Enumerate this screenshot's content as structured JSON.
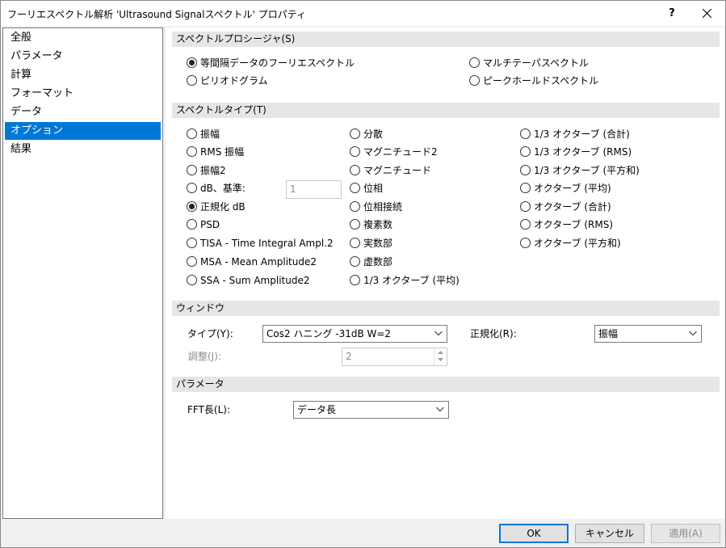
{
  "window": {
    "title": "フーリエスペクトル解析 'Ultrasound Signalスペクトル' プロパティ",
    "help_label": "?"
  },
  "sidebar": {
    "items": [
      {
        "label": "全般"
      },
      {
        "label": "パラメータ"
      },
      {
        "label": "計算"
      },
      {
        "label": "フォーマット"
      },
      {
        "label": "データ"
      },
      {
        "label": "オプション",
        "selected": true
      },
      {
        "label": "結果"
      }
    ]
  },
  "procedure": {
    "header": "スペクトルプロシージャ(S)",
    "options": [
      {
        "label": "等間隔データのフーリエスペクトル",
        "checked": true
      },
      {
        "label": "マルチテーパスペクトル",
        "checked": false
      },
      {
        "label": "ピリオドグラム",
        "checked": false
      },
      {
        "label": "ピークホールドスペクトル",
        "checked": false
      }
    ]
  },
  "spectrum_type": {
    "header": "スペクトルタイプ(T)",
    "col1": [
      {
        "label": "振幅",
        "checked": false
      },
      {
        "label": "RMS 振幅",
        "checked": false
      },
      {
        "label": "振幅2",
        "checked": false
      },
      {
        "label": "dB、基準:",
        "checked": false
      },
      {
        "label": "正規化 dB",
        "checked": true
      },
      {
        "label": "PSD",
        "checked": false
      },
      {
        "label": "TISA - Time Integral Ampl.2",
        "checked": false
      },
      {
        "label": "MSA - Mean Amplitude2",
        "checked": false
      },
      {
        "label": "SSA - Sum Amplitude2",
        "checked": false
      }
    ],
    "col2": [
      {
        "label": "分散",
        "checked": false
      },
      {
        "label": "マグニチュード2",
        "checked": false
      },
      {
        "label": "マグニチュード",
        "checked": false
      },
      {
        "label": "位相",
        "checked": false
      },
      {
        "label": "位相接続",
        "checked": false
      },
      {
        "label": "複素数",
        "checked": false
      },
      {
        "label": "実数部",
        "checked": false
      },
      {
        "label": "虚数部",
        "checked": false
      },
      {
        "label": "1/3 オクターブ (平均)",
        "checked": false
      }
    ],
    "col3": [
      {
        "label": "1/3 オクターブ (合計)",
        "checked": false
      },
      {
        "label": "1/3 オクターブ (RMS)",
        "checked": false
      },
      {
        "label": "1/3 オクターブ (平方和)",
        "checked": false
      },
      {
        "label": "オクターブ (平均)",
        "checked": false
      },
      {
        "label": "オクターブ (合計)",
        "checked": false
      },
      {
        "label": "オクターブ (RMS)",
        "checked": false
      },
      {
        "label": "オクターブ (平方和)",
        "checked": false
      }
    ],
    "db_reference_value": "1"
  },
  "window_section": {
    "header": "ウィンドウ",
    "type_label": "タイプ(Y):",
    "type_value": "Cos2 ハニング -31dB W=2",
    "normalize_label": "正規化(R):",
    "normalize_value": "振幅",
    "adjust_label": "調整(J):",
    "adjust_value": "2"
  },
  "parameters": {
    "header": "パラメータ",
    "fft_label": "FFT長(L):",
    "fft_value": "データ長"
  },
  "buttons": {
    "ok": "OK",
    "cancel": "キャンセル",
    "apply": "適用(A)"
  },
  "colors": {
    "accent": "#0078d7",
    "section_bg": "#e6e6e6",
    "disabled_text": "#8d8d8d"
  }
}
